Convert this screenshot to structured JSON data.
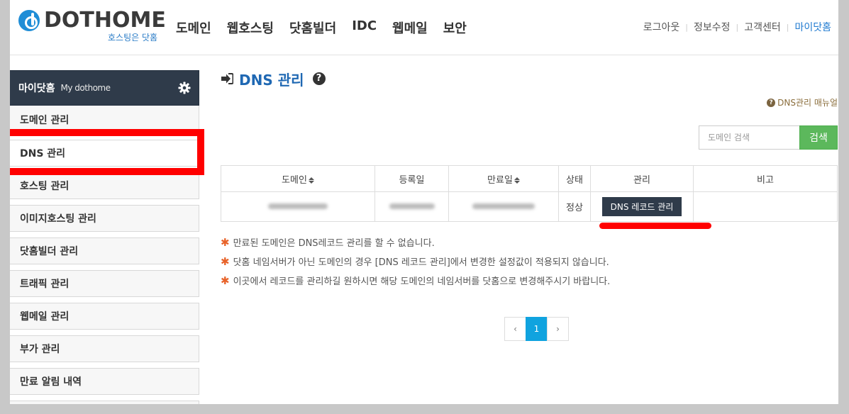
{
  "header": {
    "logo_text": "DOTHOME",
    "logo_sub": "호스팅은 닷홈",
    "nav": [
      "도메인",
      "웹호스팅",
      "닷홈빌더",
      "IDC",
      "웹메일",
      "보안"
    ],
    "util": [
      "로그아웃",
      "정보수정",
      "고객센터",
      "마이닷홈"
    ]
  },
  "sidebar": {
    "title": "마이닷홈",
    "title_en": "My dothome",
    "items": [
      "도메인 관리",
      "DNS 관리",
      "호스팅 관리",
      "이미지호스팅 관리",
      "닷홈빌더 관리",
      "트래픽 관리",
      "웹메일 관리",
      "부가 관리",
      "만료 알림 내역"
    ]
  },
  "main": {
    "title": "DNS 관리",
    "manual": "DNS관리 매뉴얼",
    "search_placeholder": "도메인 검색",
    "search_button": "검색",
    "columns": [
      "도메인",
      "등록일",
      "만료일",
      "상태",
      "관리",
      "비고"
    ],
    "row": {
      "status": "정상",
      "manage": "DNS 레코드 관리",
      "note": ""
    },
    "notes": [
      "만료된 도메인은 DNS레코드 관리를 할 수 없습니다.",
      "닷홈 네임서버가 아닌 도메인의 경우 [DNS 레코드 관리]에서 변경한 설정값이 적용되지 않습니다.",
      "이곳에서 레코드를 관리하길 원하시면 해당 도메인의 네임서버를 닷홈으로 변경해주시기 바랍니다."
    ],
    "pager": {
      "prev": "‹",
      "current": "1",
      "next": "›"
    }
  },
  "colors": {
    "accent": "#1f68b3",
    "highlight": "#ff0000",
    "search": "#5cb85c",
    "page_current": "#10a3df"
  }
}
